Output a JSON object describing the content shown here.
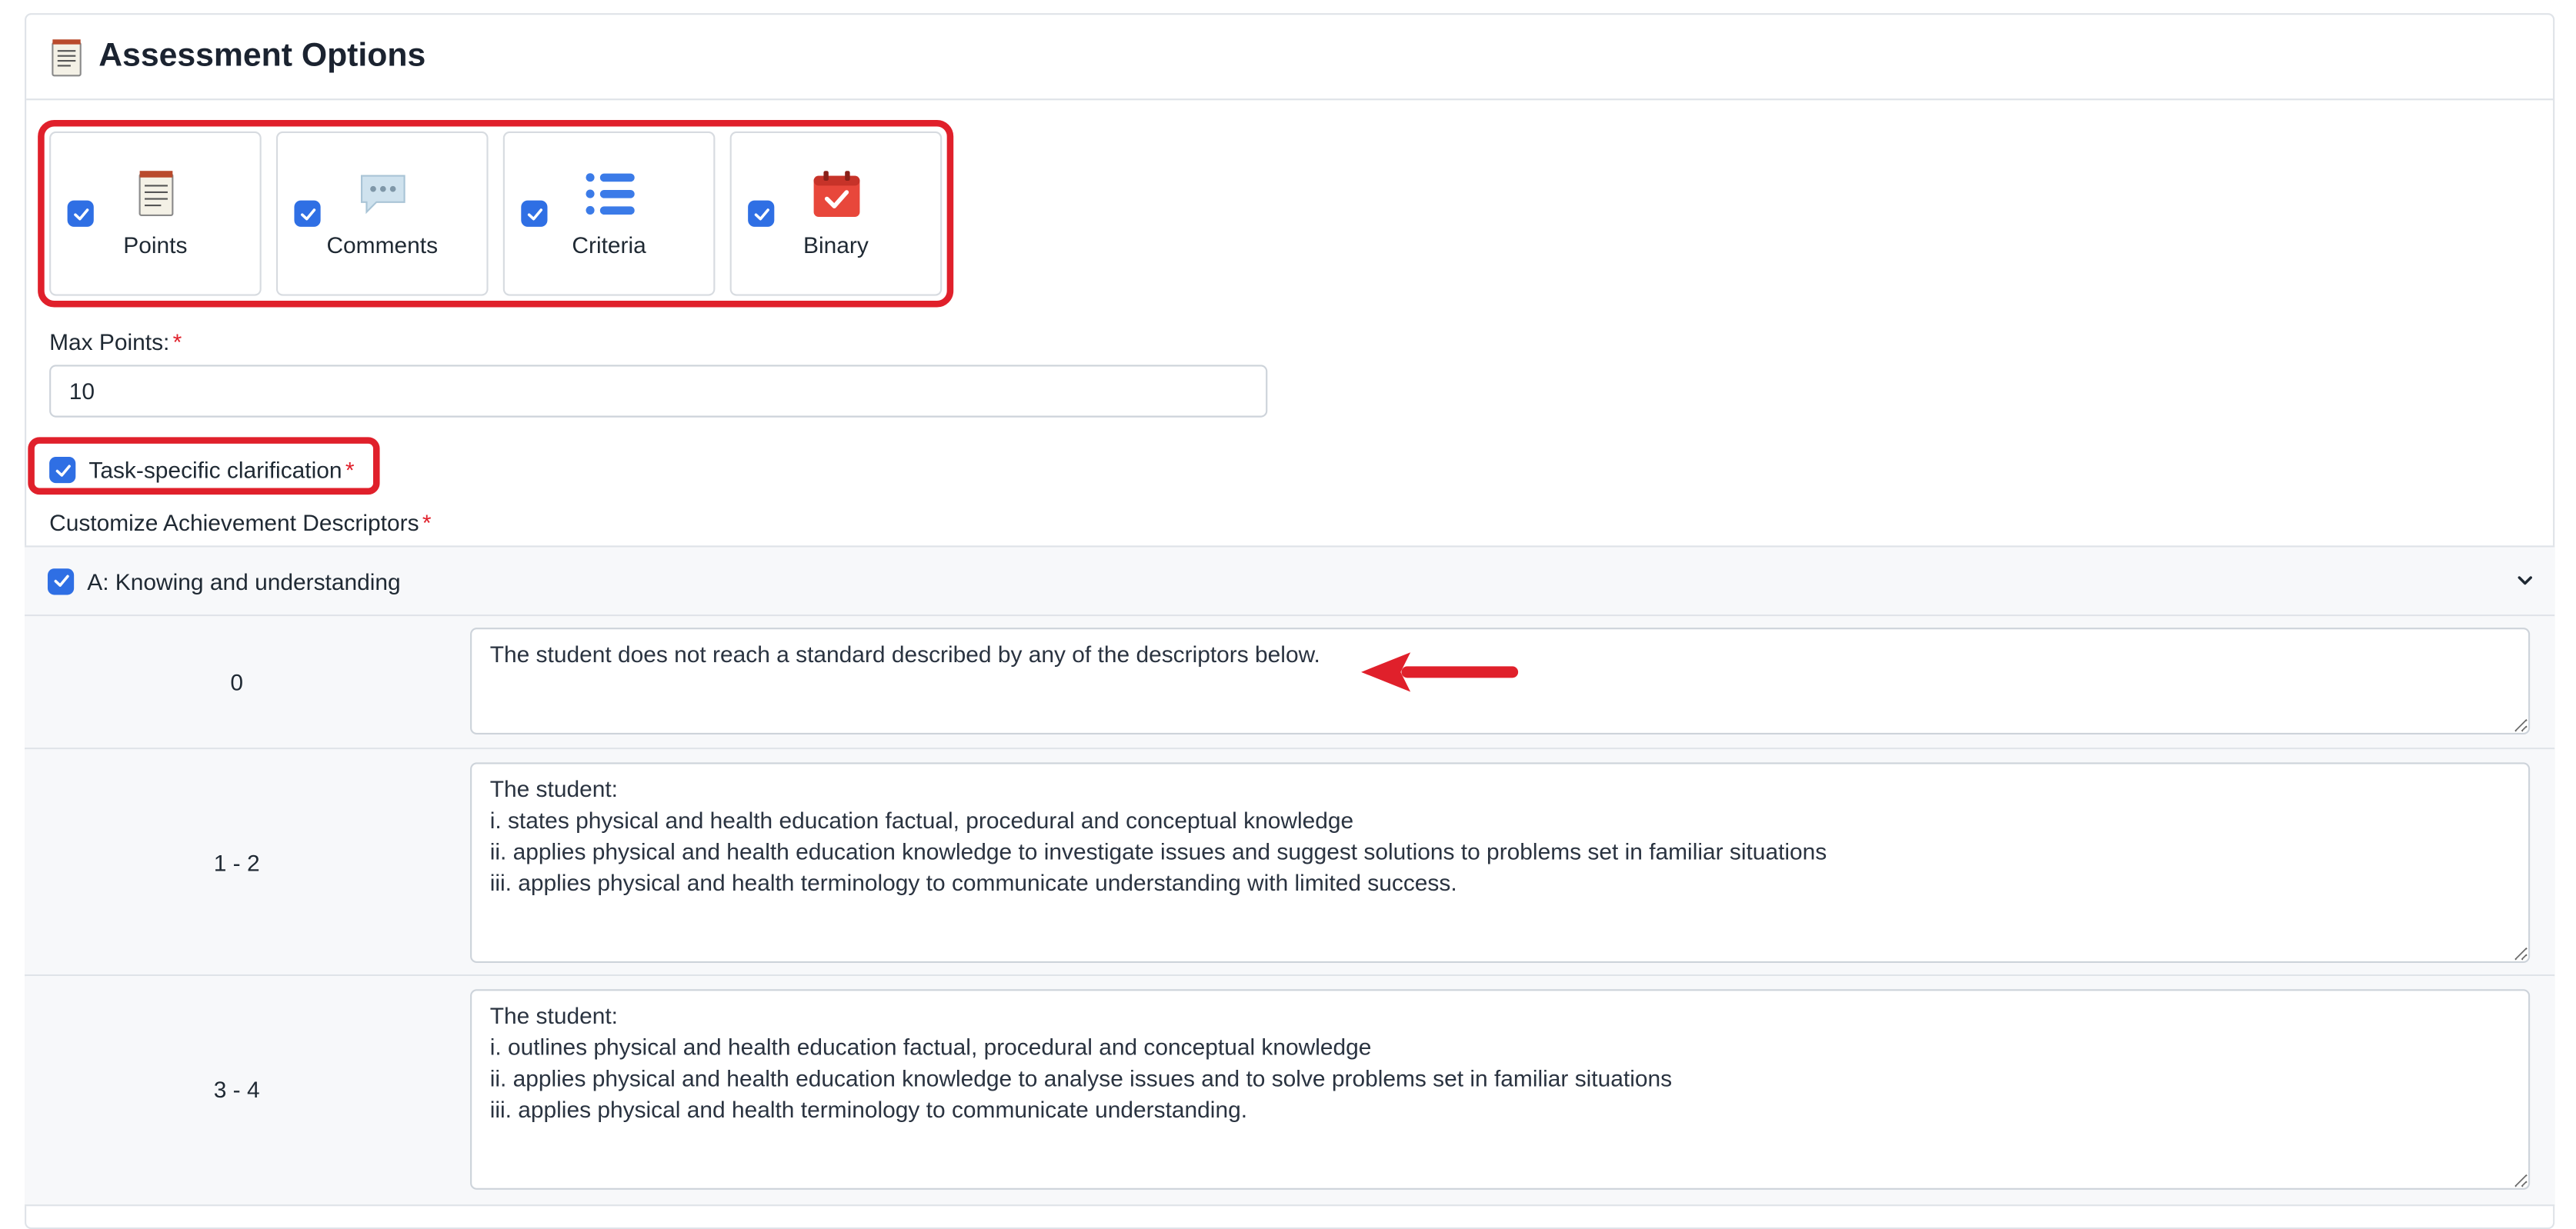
{
  "header": {
    "title": "Assessment Options",
    "icon": "notepad-icon"
  },
  "options": [
    {
      "label": "Points",
      "icon": "notepad-icon",
      "checked": true
    },
    {
      "label": "Comments",
      "icon": "speech-bubble-icon",
      "checked": true
    },
    {
      "label": "Criteria",
      "icon": "list-icon",
      "checked": true
    },
    {
      "label": "Binary",
      "icon": "calendar-check-icon",
      "checked": true
    }
  ],
  "max_points": {
    "label": "Max Points:",
    "required": "*",
    "value": "10"
  },
  "task_clarification": {
    "label": "Task-specific clarification",
    "required": "*",
    "checked": true
  },
  "descriptors": {
    "label": "Customize Achievement Descriptors",
    "required": "*",
    "criterion": {
      "label": "A: Knowing and understanding",
      "checked": true
    },
    "levels": [
      {
        "level": "0",
        "text": "The student does not reach a standard described by any of the descriptors below."
      },
      {
        "level": "1 - 2",
        "text": "The student:\ni. states physical and health education factual, procedural and conceptual knowledge\nii. applies physical and health education knowledge to investigate issues and suggest solutions to problems set in familiar situations\niii. applies physical and health terminology to communicate understanding with limited success."
      },
      {
        "level": "3 - 4",
        "text": "The student:\ni. outlines physical and health education factual, procedural and conceptual knowledge\nii. applies physical and health education knowledge to analyse issues and to solve problems set in familiar situations\niii. applies physical and health terminology to communicate understanding."
      }
    ]
  },
  "colors": {
    "accent": "#2f6fe4",
    "highlight": "#e0202b",
    "required": "#e0202b"
  }
}
